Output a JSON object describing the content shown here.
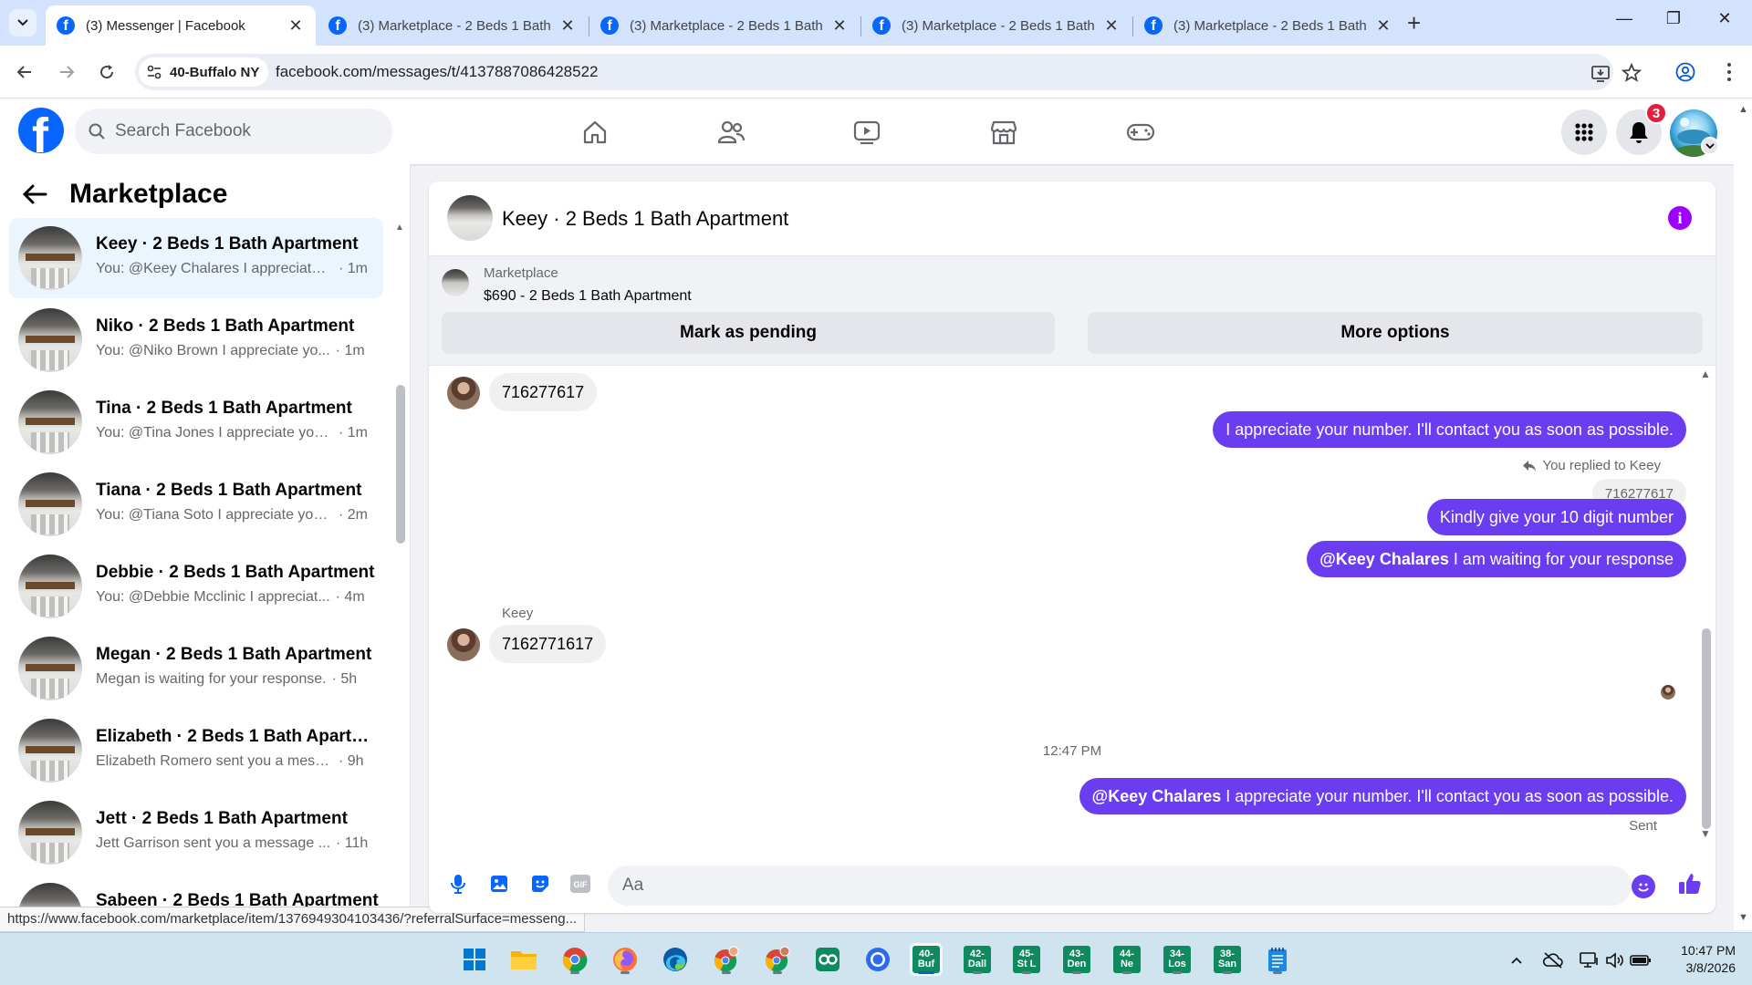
{
  "browser": {
    "tabs": [
      {
        "title": "(3) Messenger | Facebook",
        "active": true
      },
      {
        "title": "(3) Marketplace - 2 Beds 1 Bath",
        "active": false
      },
      {
        "title": "(3) Marketplace - 2 Beds 1 Bath",
        "active": false
      },
      {
        "title": "(3) Marketplace - 2 Beds 1 Bath",
        "active": false
      },
      {
        "title": "(3) Marketplace - 2 Beds 1 Bath",
        "active": false
      }
    ],
    "site_chip": "40-Buffalo NY",
    "url": "facebook.com/messages/t/4137887086428522",
    "status_url": "https://www.facebook.com/marketplace/item/1376949304103436/?referralSurface=messeng..."
  },
  "facebook": {
    "search_placeholder": "Search Facebook",
    "notification_count": "3",
    "sidebar_title": "Marketplace",
    "conversations": [
      {
        "name": "Keey · 2 Beds 1 Bath Apartment",
        "preview": "You: @Keey Chalares I appreciate ...",
        "time": "· 1m",
        "selected": true
      },
      {
        "name": "Niko · 2 Beds 1 Bath Apartment",
        "preview": "You: @Niko Brown I appreciate yo...",
        "time": "· 1m"
      },
      {
        "name": "Tina · 2 Beds 1 Bath Apartment",
        "preview": "You: @Tina Jones I appreciate your...",
        "time": "· 1m"
      },
      {
        "name": "Tiana · 2 Beds 1 Bath Apartment",
        "preview": "You: @Tiana Soto I appreciate you...",
        "time": "· 2m"
      },
      {
        "name": "Debbie · 2 Beds 1 Bath Apartment",
        "preview": "You: @Debbie Mcclinic I appreciat...",
        "time": "· 4m"
      },
      {
        "name": "Megan · 2 Beds 1 Bath Apartment",
        "preview": "Megan is waiting for your response.",
        "time": "· 5h"
      },
      {
        "name": "Elizabeth · 2 Beds 1 Bath Apartm...",
        "preview": "Elizabeth Romero sent you a messa...",
        "time": "· 9h"
      },
      {
        "name": "Jett · 2 Beds 1 Bath Apartment",
        "preview": "Jett Garrison sent you a message ...",
        "time": "· 11h"
      },
      {
        "name": "Sabeen · 2 Beds 1 Bath Apartment",
        "preview": "",
        "time": ""
      }
    ]
  },
  "chat": {
    "title": "Keey · 2 Beds 1 Bath Apartment",
    "marketplace_label": "Marketplace",
    "listing": "$690 - 2 Beds 1 Bath Apartment",
    "mark_pending": "Mark as pending",
    "more_options": "More options",
    "msg1_in": "716277617",
    "msg2_out": "I appreciate your number. I'll contact you as soon as possible.",
    "reply_note": "You replied to Keey",
    "reply_quote": "716277617",
    "msg3_out": "Kindly give your 10 digit number",
    "msg4_mention": "@Keey Chalares",
    "msg4_text": "I am waiting for your response",
    "sender_name": "Keey",
    "msg5_in": "7162771617",
    "timestamp": "12:47 PM",
    "msg6_mention": "@Keey Chalares",
    "msg6_text": "I appreciate your number. I'll contact you as soon as possible.",
    "sent_label": "Sent",
    "composer_placeholder": "Aa"
  },
  "taskbar": {
    "tiles": [
      [
        "40-",
        "Buf"
      ],
      [
        "42-",
        "Dall"
      ],
      [
        "45-",
        "St L"
      ],
      [
        "43-",
        "Den"
      ],
      [
        "44-",
        "Ne"
      ],
      [
        "34-",
        "Los"
      ],
      [
        "38-",
        "San"
      ]
    ],
    "time": "10:47 PM",
    "date": "3/8/2026"
  },
  "colors": {
    "brand_blue": "#0866ff",
    "outgoing_bubble": "#6b3df1",
    "info_purple": "#9d00ff",
    "badge_red": "#e41e3f"
  }
}
